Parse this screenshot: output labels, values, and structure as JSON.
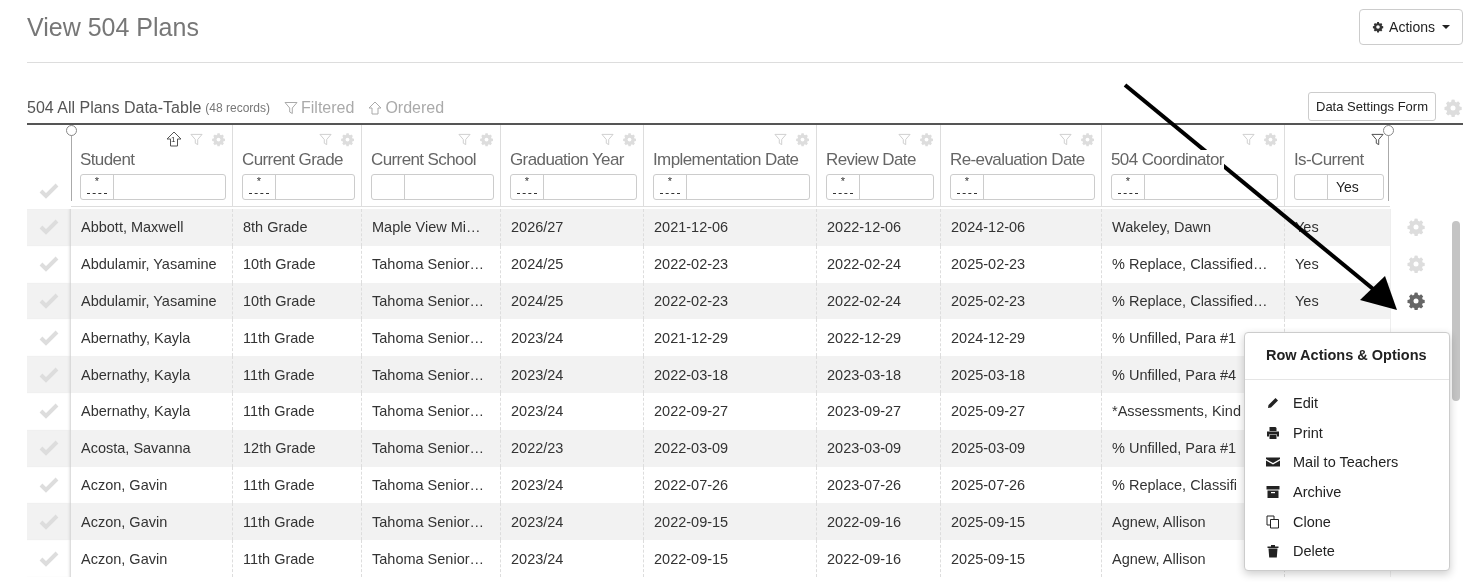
{
  "page_title": "View 504 Plans",
  "actions_button": "Actions",
  "table_title": "504 All Plans Data-Table",
  "record_count": "(48 records)",
  "filtered_label": "Filtered",
  "ordered_label": "Ordered",
  "settings_button": "Data Settings Form",
  "columns": [
    {
      "label": "Student",
      "prefix": "*",
      "sort_order": "1",
      "filter_active": false
    },
    {
      "label": "Current Grade",
      "prefix": "*",
      "filter_active": false
    },
    {
      "label": "Current School",
      "filter_active": false
    },
    {
      "label": "Graduation Year",
      "prefix": "*",
      "filter_active": false
    },
    {
      "label": "Implementation Date",
      "prefix": "*",
      "filter_active": false
    },
    {
      "label": "Review Date",
      "prefix": "*",
      "filter_active": false
    },
    {
      "label": "Re-evaluation Date",
      "prefix": "*",
      "filter_active": false
    },
    {
      "label": "504 Coordinator",
      "prefix": "*",
      "filter_active": false
    },
    {
      "label": "Is-Current",
      "value": "Yes",
      "filter_active": true
    }
  ],
  "rows": [
    {
      "checked": false,
      "cells": [
        "Abbott, Maxwell",
        "8th Grade",
        "Maple View Mi…",
        "2026/27",
        "2021-12-06",
        "2022-12-06",
        "2024-12-06",
        "Wakeley, Dawn",
        "Yes"
      ],
      "gear_active": false
    },
    {
      "checked": false,
      "cells": [
        "Abdulamir, Yasamine",
        "10th Grade",
        "Tahoma Senior…",
        "2024/25",
        "2022-02-23",
        "2022-02-24",
        "2025-02-23",
        "% Replace, Classified…",
        "Yes"
      ],
      "gear_active": false
    },
    {
      "checked": false,
      "cells": [
        "Abdulamir, Yasamine",
        "10th Grade",
        "Tahoma Senior…",
        "2024/25",
        "2022-02-23",
        "2022-02-24",
        "2025-02-23",
        "% Replace, Classified…",
        "Yes"
      ],
      "gear_active": true
    },
    {
      "checked": false,
      "cells": [
        "Abernathy, Kayla",
        "11th Grade",
        "Tahoma Senior…",
        "2023/24",
        "2021-12-29",
        "2022-12-29",
        "2024-12-29",
        "% Unfilled, Para #1"
      ]
    },
    {
      "checked": false,
      "cells": [
        "Abernathy, Kayla",
        "11th Grade",
        "Tahoma Senior…",
        "2023/24",
        "2022-03-18",
        "2023-03-18",
        "2025-03-18",
        "% Unfilled, Para #4"
      ]
    },
    {
      "checked": false,
      "cells": [
        "Abernathy, Kayla",
        "11th Grade",
        "Tahoma Senior…",
        "2023/24",
        "2022-09-27",
        "2023-09-27",
        "2025-09-27",
        "*Assessments, Kind"
      ]
    },
    {
      "checked": false,
      "cells": [
        "Acosta, Savanna",
        "12th Grade",
        "Tahoma Senior…",
        "2022/23",
        "2022-03-09",
        "2023-03-09",
        "2025-03-09",
        "% Unfilled, Para #1"
      ]
    },
    {
      "checked": false,
      "cells": [
        "Aczon, Gavin",
        "11th Grade",
        "Tahoma Senior…",
        "2023/24",
        "2022-07-26",
        "2023-07-26",
        "2025-07-26",
        "% Replace, Classifi"
      ]
    },
    {
      "checked": false,
      "cells": [
        "Aczon, Gavin",
        "11th Grade",
        "Tahoma Senior…",
        "2023/24",
        "2022-09-15",
        "2022-09-16",
        "2025-09-15",
        "Agnew, Allison"
      ]
    },
    {
      "checked": false,
      "cells": [
        "Aczon, Gavin",
        "11th Grade",
        "Tahoma Senior…",
        "2023/24",
        "2022-09-15",
        "2022-09-16",
        "2025-09-15",
        "Agnew, Allison"
      ]
    }
  ],
  "row_menu": {
    "title": "Row Actions & Options",
    "items": [
      {
        "kind": "edit",
        "label": "Edit"
      },
      {
        "kind": "print",
        "label": "Print"
      },
      {
        "kind": "mail",
        "label": "Mail to Teachers"
      },
      {
        "kind": "archive",
        "label": "Archive"
      },
      {
        "kind": "clone",
        "label": "Clone"
      },
      {
        "kind": "delete",
        "label": "Delete"
      }
    ]
  }
}
